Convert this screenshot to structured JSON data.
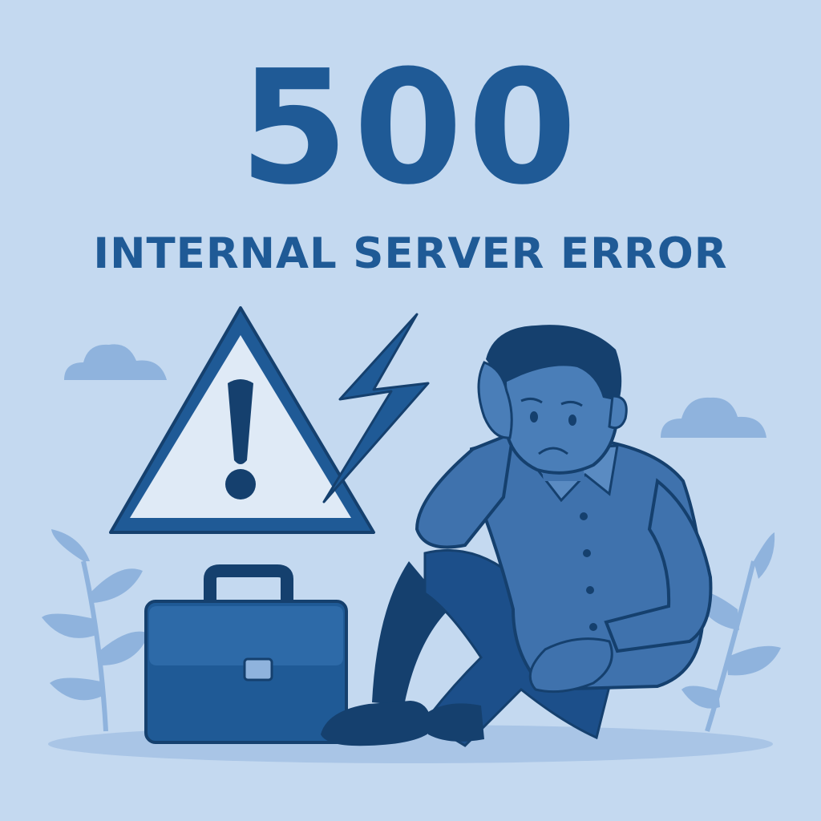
{
  "error": {
    "code": "500",
    "title": "INTERNAL SERVER ERROR"
  },
  "icons": [
    "warning-triangle-icon",
    "lightning-bolt-icon",
    "briefcase-icon",
    "cloud-icon",
    "leaf-plant-icon"
  ],
  "colors": {
    "background": "#c4d9f0",
    "primary": "#1f5a96",
    "dark": "#15406e",
    "mid": "#3f72ad",
    "light": "#8fb3dd",
    "pale": "#dfeaf6"
  }
}
